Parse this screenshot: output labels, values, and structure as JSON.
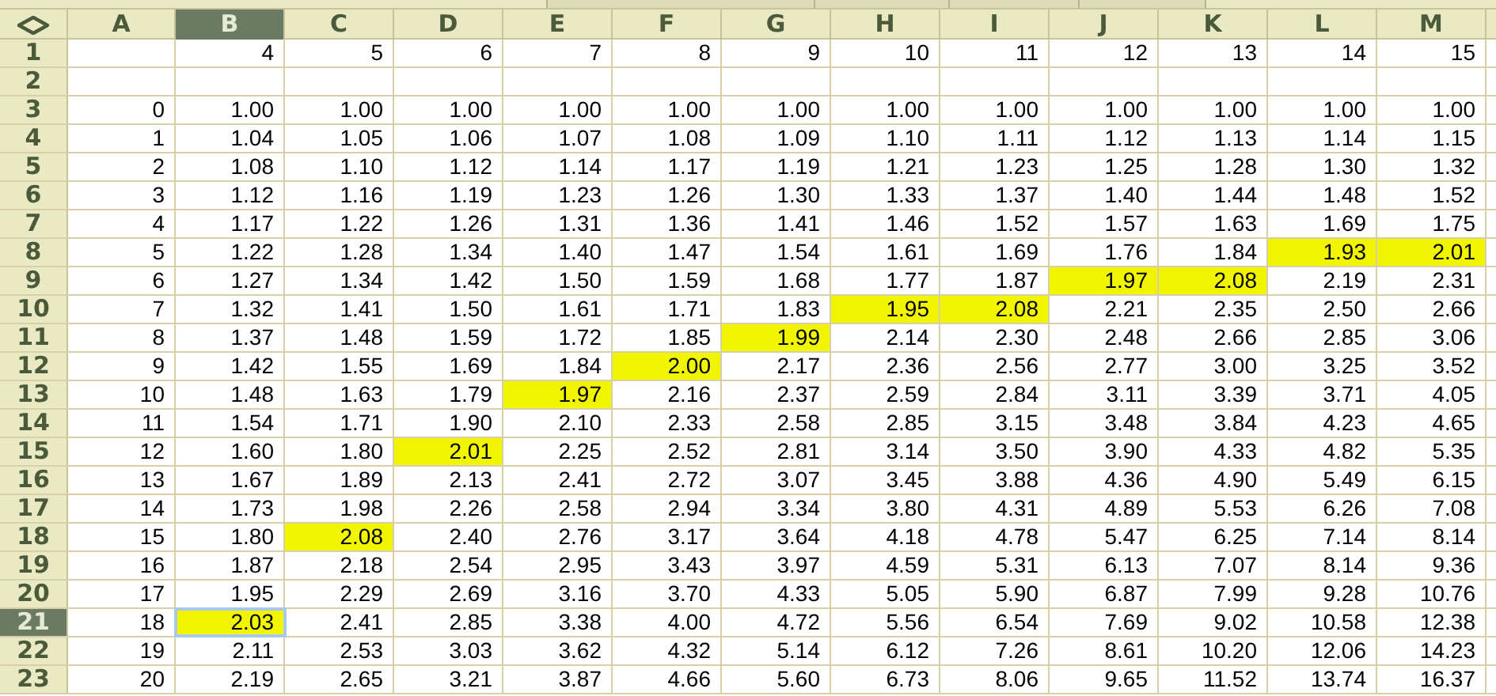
{
  "columns": [
    {
      "label": "A",
      "selected": false
    },
    {
      "label": "B",
      "selected": true
    },
    {
      "label": "C",
      "selected": false
    },
    {
      "label": "D",
      "selected": false
    },
    {
      "label": "E",
      "selected": false
    },
    {
      "label": "F",
      "selected": false
    },
    {
      "label": "G",
      "selected": false
    },
    {
      "label": "H",
      "selected": false
    },
    {
      "label": "I",
      "selected": false
    },
    {
      "label": "J",
      "selected": false
    },
    {
      "label": "K",
      "selected": false
    },
    {
      "label": "L",
      "selected": false
    },
    {
      "label": "M",
      "selected": false
    }
  ],
  "rows": [
    {
      "header": "1",
      "selected": false,
      "cells": [
        {
          "highlighted": false,
          "selected": false
        },
        {
          "text": "4",
          "highlighted": false,
          "selected": false
        },
        {
          "text": "5",
          "highlighted": false,
          "selected": false
        },
        {
          "text": "6",
          "highlighted": false,
          "selected": false
        },
        {
          "text": "7",
          "highlighted": false,
          "selected": false
        },
        {
          "text": "8",
          "highlighted": false,
          "selected": false
        },
        {
          "text": "9",
          "highlighted": false,
          "selected": false
        },
        {
          "text": "10",
          "highlighted": false,
          "selected": false
        },
        {
          "text": "11",
          "highlighted": false,
          "selected": false
        },
        {
          "text": "12",
          "highlighted": false,
          "selected": false
        },
        {
          "text": "13",
          "highlighted": false,
          "selected": false
        },
        {
          "text": "14",
          "highlighted": false,
          "selected": false
        },
        {
          "text": "15",
          "highlighted": false,
          "selected": false
        }
      ]
    },
    {
      "header": "2",
      "selected": false,
      "cells": [
        {
          "highlighted": false,
          "selected": false
        },
        {
          "highlighted": false,
          "selected": false
        },
        {
          "highlighted": false,
          "selected": false
        },
        {
          "highlighted": false,
          "selected": false
        },
        {
          "highlighted": false,
          "selected": false
        },
        {
          "highlighted": false,
          "selected": false
        },
        {
          "highlighted": false,
          "selected": false
        },
        {
          "highlighted": false,
          "selected": false
        },
        {
          "highlighted": false,
          "selected": false
        },
        {
          "highlighted": false,
          "selected": false
        },
        {
          "highlighted": false,
          "selected": false
        },
        {
          "highlighted": false,
          "selected": false
        },
        {
          "highlighted": false,
          "selected": false
        }
      ]
    },
    {
      "header": "3",
      "selected": false,
      "cells": [
        {
          "text": "0",
          "highlighted": false,
          "selected": false
        },
        {
          "text": "1.00",
          "highlighted": false,
          "selected": false
        },
        {
          "text": "1.00",
          "highlighted": false,
          "selected": false
        },
        {
          "text": "1.00",
          "highlighted": false,
          "selected": false
        },
        {
          "text": "1.00",
          "highlighted": false,
          "selected": false
        },
        {
          "text": "1.00",
          "highlighted": false,
          "selected": false
        },
        {
          "text": "1.00",
          "highlighted": false,
          "selected": false
        },
        {
          "text": "1.00",
          "highlighted": false,
          "selected": false
        },
        {
          "text": "1.00",
          "highlighted": false,
          "selected": false
        },
        {
          "text": "1.00",
          "highlighted": false,
          "selected": false
        },
        {
          "text": "1.00",
          "highlighted": false,
          "selected": false
        },
        {
          "text": "1.00",
          "highlighted": false,
          "selected": false
        },
        {
          "text": "1.00",
          "highlighted": false,
          "selected": false
        }
      ]
    },
    {
      "header": "4",
      "selected": false,
      "cells": [
        {
          "text": "1",
          "highlighted": false,
          "selected": false
        },
        {
          "text": "1.04",
          "highlighted": false,
          "selected": false
        },
        {
          "text": "1.05",
          "highlighted": false,
          "selected": false
        },
        {
          "text": "1.06",
          "highlighted": false,
          "selected": false
        },
        {
          "text": "1.07",
          "highlighted": false,
          "selected": false
        },
        {
          "text": "1.08",
          "highlighted": false,
          "selected": false
        },
        {
          "text": "1.09",
          "highlighted": false,
          "selected": false
        },
        {
          "text": "1.10",
          "highlighted": false,
          "selected": false
        },
        {
          "text": "1.11",
          "highlighted": false,
          "selected": false
        },
        {
          "text": "1.12",
          "highlighted": false,
          "selected": false
        },
        {
          "text": "1.13",
          "highlighted": false,
          "selected": false
        },
        {
          "text": "1.14",
          "highlighted": false,
          "selected": false
        },
        {
          "text": "1.15",
          "highlighted": false,
          "selected": false
        }
      ]
    },
    {
      "header": "5",
      "selected": false,
      "cells": [
        {
          "text": "2",
          "highlighted": false,
          "selected": false
        },
        {
          "text": "1.08",
          "highlighted": false,
          "selected": false
        },
        {
          "text": "1.10",
          "highlighted": false,
          "selected": false
        },
        {
          "text": "1.12",
          "highlighted": false,
          "selected": false
        },
        {
          "text": "1.14",
          "highlighted": false,
          "selected": false
        },
        {
          "text": "1.17",
          "highlighted": false,
          "selected": false
        },
        {
          "text": "1.19",
          "highlighted": false,
          "selected": false
        },
        {
          "text": "1.21",
          "highlighted": false,
          "selected": false
        },
        {
          "text": "1.23",
          "highlighted": false,
          "selected": false
        },
        {
          "text": "1.25",
          "highlighted": false,
          "selected": false
        },
        {
          "text": "1.28",
          "highlighted": false,
          "selected": false
        },
        {
          "text": "1.30",
          "highlighted": false,
          "selected": false
        },
        {
          "text": "1.32",
          "highlighted": false,
          "selected": false
        }
      ]
    },
    {
      "header": "6",
      "selected": false,
      "cells": [
        {
          "text": "3",
          "highlighted": false,
          "selected": false
        },
        {
          "text": "1.12",
          "highlighted": false,
          "selected": false
        },
        {
          "text": "1.16",
          "highlighted": false,
          "selected": false
        },
        {
          "text": "1.19",
          "highlighted": false,
          "selected": false
        },
        {
          "text": "1.23",
          "highlighted": false,
          "selected": false
        },
        {
          "text": "1.26",
          "highlighted": false,
          "selected": false
        },
        {
          "text": "1.30",
          "highlighted": false,
          "selected": false
        },
        {
          "text": "1.33",
          "highlighted": false,
          "selected": false
        },
        {
          "text": "1.37",
          "highlighted": false,
          "selected": false
        },
        {
          "text": "1.40",
          "highlighted": false,
          "selected": false
        },
        {
          "text": "1.44",
          "highlighted": false,
          "selected": false
        },
        {
          "text": "1.48",
          "highlighted": false,
          "selected": false
        },
        {
          "text": "1.52",
          "highlighted": false,
          "selected": false
        }
      ]
    },
    {
      "header": "7",
      "selected": false,
      "cells": [
        {
          "text": "4",
          "highlighted": false,
          "selected": false
        },
        {
          "text": "1.17",
          "highlighted": false,
          "selected": false
        },
        {
          "text": "1.22",
          "highlighted": false,
          "selected": false
        },
        {
          "text": "1.26",
          "highlighted": false,
          "selected": false
        },
        {
          "text": "1.31",
          "highlighted": false,
          "selected": false
        },
        {
          "text": "1.36",
          "highlighted": false,
          "selected": false
        },
        {
          "text": "1.41",
          "highlighted": false,
          "selected": false
        },
        {
          "text": "1.46",
          "highlighted": false,
          "selected": false
        },
        {
          "text": "1.52",
          "highlighted": false,
          "selected": false
        },
        {
          "text": "1.57",
          "highlighted": false,
          "selected": false
        },
        {
          "text": "1.63",
          "highlighted": false,
          "selected": false
        },
        {
          "text": "1.69",
          "highlighted": false,
          "selected": false
        },
        {
          "text": "1.75",
          "highlighted": false,
          "selected": false
        }
      ]
    },
    {
      "header": "8",
      "selected": false,
      "cells": [
        {
          "text": "5",
          "highlighted": false,
          "selected": false
        },
        {
          "text": "1.22",
          "highlighted": false,
          "selected": false
        },
        {
          "text": "1.28",
          "highlighted": false,
          "selected": false
        },
        {
          "text": "1.34",
          "highlighted": false,
          "selected": false
        },
        {
          "text": "1.40",
          "highlighted": false,
          "selected": false
        },
        {
          "text": "1.47",
          "highlighted": false,
          "selected": false
        },
        {
          "text": "1.54",
          "highlighted": false,
          "selected": false
        },
        {
          "text": "1.61",
          "highlighted": false,
          "selected": false
        },
        {
          "text": "1.69",
          "highlighted": false,
          "selected": false
        },
        {
          "text": "1.76",
          "highlighted": false,
          "selected": false
        },
        {
          "text": "1.84",
          "highlighted": false,
          "selected": false
        },
        {
          "text": "1.93",
          "highlighted": true,
          "selected": false
        },
        {
          "text": "2.01",
          "highlighted": true,
          "selected": false
        }
      ]
    },
    {
      "header": "9",
      "selected": false,
      "cells": [
        {
          "text": "6",
          "highlighted": false,
          "selected": false
        },
        {
          "text": "1.27",
          "highlighted": false,
          "selected": false
        },
        {
          "text": "1.34",
          "highlighted": false,
          "selected": false
        },
        {
          "text": "1.42",
          "highlighted": false,
          "selected": false
        },
        {
          "text": "1.50",
          "highlighted": false,
          "selected": false
        },
        {
          "text": "1.59",
          "highlighted": false,
          "selected": false
        },
        {
          "text": "1.68",
          "highlighted": false,
          "selected": false
        },
        {
          "text": "1.77",
          "highlighted": false,
          "selected": false
        },
        {
          "text": "1.87",
          "highlighted": false,
          "selected": false
        },
        {
          "text": "1.97",
          "highlighted": true,
          "selected": false
        },
        {
          "text": "2.08",
          "highlighted": true,
          "selected": false
        },
        {
          "text": "2.19",
          "highlighted": false,
          "selected": false
        },
        {
          "text": "2.31",
          "highlighted": false,
          "selected": false
        }
      ]
    },
    {
      "header": "10",
      "selected": false,
      "cells": [
        {
          "text": "7",
          "highlighted": false,
          "selected": false
        },
        {
          "text": "1.32",
          "highlighted": false,
          "selected": false
        },
        {
          "text": "1.41",
          "highlighted": false,
          "selected": false
        },
        {
          "text": "1.50",
          "highlighted": false,
          "selected": false
        },
        {
          "text": "1.61",
          "highlighted": false,
          "selected": false
        },
        {
          "text": "1.71",
          "highlighted": false,
          "selected": false
        },
        {
          "text": "1.83",
          "highlighted": false,
          "selected": false
        },
        {
          "text": "1.95",
          "highlighted": true,
          "selected": false
        },
        {
          "text": "2.08",
          "highlighted": true,
          "selected": false
        },
        {
          "text": "2.21",
          "highlighted": false,
          "selected": false
        },
        {
          "text": "2.35",
          "highlighted": false,
          "selected": false
        },
        {
          "text": "2.50",
          "highlighted": false,
          "selected": false
        },
        {
          "text": "2.66",
          "highlighted": false,
          "selected": false
        }
      ]
    },
    {
      "header": "11",
      "selected": false,
      "cells": [
        {
          "text": "8",
          "highlighted": false,
          "selected": false
        },
        {
          "text": "1.37",
          "highlighted": false,
          "selected": false
        },
        {
          "text": "1.48",
          "highlighted": false,
          "selected": false
        },
        {
          "text": "1.59",
          "highlighted": false,
          "selected": false
        },
        {
          "text": "1.72",
          "highlighted": false,
          "selected": false
        },
        {
          "text": "1.85",
          "highlighted": false,
          "selected": false
        },
        {
          "text": "1.99",
          "highlighted": true,
          "selected": false
        },
        {
          "text": "2.14",
          "highlighted": false,
          "selected": false
        },
        {
          "text": "2.30",
          "highlighted": false,
          "selected": false
        },
        {
          "text": "2.48",
          "highlighted": false,
          "selected": false
        },
        {
          "text": "2.66",
          "highlighted": false,
          "selected": false
        },
        {
          "text": "2.85",
          "highlighted": false,
          "selected": false
        },
        {
          "text": "3.06",
          "highlighted": false,
          "selected": false
        }
      ]
    },
    {
      "header": "12",
      "selected": false,
      "cells": [
        {
          "text": "9",
          "highlighted": false,
          "selected": false
        },
        {
          "text": "1.42",
          "highlighted": false,
          "selected": false
        },
        {
          "text": "1.55",
          "highlighted": false,
          "selected": false
        },
        {
          "text": "1.69",
          "highlighted": false,
          "selected": false
        },
        {
          "text": "1.84",
          "highlighted": false,
          "selected": false
        },
        {
          "text": "2.00",
          "highlighted": true,
          "selected": false
        },
        {
          "text": "2.17",
          "highlighted": false,
          "selected": false
        },
        {
          "text": "2.36",
          "highlighted": false,
          "selected": false
        },
        {
          "text": "2.56",
          "highlighted": false,
          "selected": false
        },
        {
          "text": "2.77",
          "highlighted": false,
          "selected": false
        },
        {
          "text": "3.00",
          "highlighted": false,
          "selected": false
        },
        {
          "text": "3.25",
          "highlighted": false,
          "selected": false
        },
        {
          "text": "3.52",
          "highlighted": false,
          "selected": false
        }
      ]
    },
    {
      "header": "13",
      "selected": false,
      "cells": [
        {
          "text": "10",
          "highlighted": false,
          "selected": false
        },
        {
          "text": "1.48",
          "highlighted": false,
          "selected": false
        },
        {
          "text": "1.63",
          "highlighted": false,
          "selected": false
        },
        {
          "text": "1.79",
          "highlighted": false,
          "selected": false
        },
        {
          "text": "1.97",
          "highlighted": true,
          "selected": false
        },
        {
          "text": "2.16",
          "highlighted": false,
          "selected": false
        },
        {
          "text": "2.37",
          "highlighted": false,
          "selected": false
        },
        {
          "text": "2.59",
          "highlighted": false,
          "selected": false
        },
        {
          "text": "2.84",
          "highlighted": false,
          "selected": false
        },
        {
          "text": "3.11",
          "highlighted": false,
          "selected": false
        },
        {
          "text": "3.39",
          "highlighted": false,
          "selected": false
        },
        {
          "text": "3.71",
          "highlighted": false,
          "selected": false
        },
        {
          "text": "4.05",
          "highlighted": false,
          "selected": false
        }
      ]
    },
    {
      "header": "14",
      "selected": false,
      "cells": [
        {
          "text": "11",
          "highlighted": false,
          "selected": false
        },
        {
          "text": "1.54",
          "highlighted": false,
          "selected": false
        },
        {
          "text": "1.71",
          "highlighted": false,
          "selected": false
        },
        {
          "text": "1.90",
          "highlighted": false,
          "selected": false
        },
        {
          "text": "2.10",
          "highlighted": false,
          "selected": false
        },
        {
          "text": "2.33",
          "highlighted": false,
          "selected": false
        },
        {
          "text": "2.58",
          "highlighted": false,
          "selected": false
        },
        {
          "text": "2.85",
          "highlighted": false,
          "selected": false
        },
        {
          "text": "3.15",
          "highlighted": false,
          "selected": false
        },
        {
          "text": "3.48",
          "highlighted": false,
          "selected": false
        },
        {
          "text": "3.84",
          "highlighted": false,
          "selected": false
        },
        {
          "text": "4.23",
          "highlighted": false,
          "selected": false
        },
        {
          "text": "4.65",
          "highlighted": false,
          "selected": false
        }
      ]
    },
    {
      "header": "15",
      "selected": false,
      "cells": [
        {
          "text": "12",
          "highlighted": false,
          "selected": false
        },
        {
          "text": "1.60",
          "highlighted": false,
          "selected": false
        },
        {
          "text": "1.80",
          "highlighted": false,
          "selected": false
        },
        {
          "text": "2.01",
          "highlighted": true,
          "selected": false
        },
        {
          "text": "2.25",
          "highlighted": false,
          "selected": false
        },
        {
          "text": "2.52",
          "highlighted": false,
          "selected": false
        },
        {
          "text": "2.81",
          "highlighted": false,
          "selected": false
        },
        {
          "text": "3.14",
          "highlighted": false,
          "selected": false
        },
        {
          "text": "3.50",
          "highlighted": false,
          "selected": false
        },
        {
          "text": "3.90",
          "highlighted": false,
          "selected": false
        },
        {
          "text": "4.33",
          "highlighted": false,
          "selected": false
        },
        {
          "text": "4.82",
          "highlighted": false,
          "selected": false
        },
        {
          "text": "5.35",
          "highlighted": false,
          "selected": false
        }
      ]
    },
    {
      "header": "16",
      "selected": false,
      "cells": [
        {
          "text": "13",
          "highlighted": false,
          "selected": false
        },
        {
          "text": "1.67",
          "highlighted": false,
          "selected": false
        },
        {
          "text": "1.89",
          "highlighted": false,
          "selected": false
        },
        {
          "text": "2.13",
          "highlighted": false,
          "selected": false
        },
        {
          "text": "2.41",
          "highlighted": false,
          "selected": false
        },
        {
          "text": "2.72",
          "highlighted": false,
          "selected": false
        },
        {
          "text": "3.07",
          "highlighted": false,
          "selected": false
        },
        {
          "text": "3.45",
          "highlighted": false,
          "selected": false
        },
        {
          "text": "3.88",
          "highlighted": false,
          "selected": false
        },
        {
          "text": "4.36",
          "highlighted": false,
          "selected": false
        },
        {
          "text": "4.90",
          "highlighted": false,
          "selected": false
        },
        {
          "text": "5.49",
          "highlighted": false,
          "selected": false
        },
        {
          "text": "6.15",
          "highlighted": false,
          "selected": false
        }
      ]
    },
    {
      "header": "17",
      "selected": false,
      "cells": [
        {
          "text": "14",
          "highlighted": false,
          "selected": false
        },
        {
          "text": "1.73",
          "highlighted": false,
          "selected": false
        },
        {
          "text": "1.98",
          "highlighted": false,
          "selected": false
        },
        {
          "text": "2.26",
          "highlighted": false,
          "selected": false
        },
        {
          "text": "2.58",
          "highlighted": false,
          "selected": false
        },
        {
          "text": "2.94",
          "highlighted": false,
          "selected": false
        },
        {
          "text": "3.34",
          "highlighted": false,
          "selected": false
        },
        {
          "text": "3.80",
          "highlighted": false,
          "selected": false
        },
        {
          "text": "4.31",
          "highlighted": false,
          "selected": false
        },
        {
          "text": "4.89",
          "highlighted": false,
          "selected": false
        },
        {
          "text": "5.53",
          "highlighted": false,
          "selected": false
        },
        {
          "text": "6.26",
          "highlighted": false,
          "selected": false
        },
        {
          "text": "7.08",
          "highlighted": false,
          "selected": false
        }
      ]
    },
    {
      "header": "18",
      "selected": false,
      "cells": [
        {
          "text": "15",
          "highlighted": false,
          "selected": false
        },
        {
          "text": "1.80",
          "highlighted": false,
          "selected": false
        },
        {
          "text": "2.08",
          "highlighted": true,
          "selected": false
        },
        {
          "text": "2.40",
          "highlighted": false,
          "selected": false
        },
        {
          "text": "2.76",
          "highlighted": false,
          "selected": false
        },
        {
          "text": "3.17",
          "highlighted": false,
          "selected": false
        },
        {
          "text": "3.64",
          "highlighted": false,
          "selected": false
        },
        {
          "text": "4.18",
          "highlighted": false,
          "selected": false
        },
        {
          "text": "4.78",
          "highlighted": false,
          "selected": false
        },
        {
          "text": "5.47",
          "highlighted": false,
          "selected": false
        },
        {
          "text": "6.25",
          "highlighted": false,
          "selected": false
        },
        {
          "text": "7.14",
          "highlighted": false,
          "selected": false
        },
        {
          "text": "8.14",
          "highlighted": false,
          "selected": false
        }
      ]
    },
    {
      "header": "19",
      "selected": false,
      "cells": [
        {
          "text": "16",
          "highlighted": false,
          "selected": false
        },
        {
          "text": "1.87",
          "highlighted": false,
          "selected": false
        },
        {
          "text": "2.18",
          "highlighted": false,
          "selected": false
        },
        {
          "text": "2.54",
          "highlighted": false,
          "selected": false
        },
        {
          "text": "2.95",
          "highlighted": false,
          "selected": false
        },
        {
          "text": "3.43",
          "highlighted": false,
          "selected": false
        },
        {
          "text": "3.97",
          "highlighted": false,
          "selected": false
        },
        {
          "text": "4.59",
          "highlighted": false,
          "selected": false
        },
        {
          "text": "5.31",
          "highlighted": false,
          "selected": false
        },
        {
          "text": "6.13",
          "highlighted": false,
          "selected": false
        },
        {
          "text": "7.07",
          "highlighted": false,
          "selected": false
        },
        {
          "text": "8.14",
          "highlighted": false,
          "selected": false
        },
        {
          "text": "9.36",
          "highlighted": false,
          "selected": false
        }
      ]
    },
    {
      "header": "20",
      "selected": false,
      "cells": [
        {
          "text": "17",
          "highlighted": false,
          "selected": false
        },
        {
          "text": "1.95",
          "highlighted": false,
          "selected": false
        },
        {
          "text": "2.29",
          "highlighted": false,
          "selected": false
        },
        {
          "text": "2.69",
          "highlighted": false,
          "selected": false
        },
        {
          "text": "3.16",
          "highlighted": false,
          "selected": false
        },
        {
          "text": "3.70",
          "highlighted": false,
          "selected": false
        },
        {
          "text": "4.33",
          "highlighted": false,
          "selected": false
        },
        {
          "text": "5.05",
          "highlighted": false,
          "selected": false
        },
        {
          "text": "5.90",
          "highlighted": false,
          "selected": false
        },
        {
          "text": "6.87",
          "highlighted": false,
          "selected": false
        },
        {
          "text": "7.99",
          "highlighted": false,
          "selected": false
        },
        {
          "text": "9.28",
          "highlighted": false,
          "selected": false
        },
        {
          "text": "10.76",
          "highlighted": false,
          "selected": false
        }
      ]
    },
    {
      "header": "21",
      "selected": true,
      "cells": [
        {
          "text": "18",
          "highlighted": false,
          "selected": false
        },
        {
          "text": "2.03",
          "highlighted": true,
          "selected": true
        },
        {
          "text": "2.41",
          "highlighted": false,
          "selected": false
        },
        {
          "text": "2.85",
          "highlighted": false,
          "selected": false
        },
        {
          "text": "3.38",
          "highlighted": false,
          "selected": false
        },
        {
          "text": "4.00",
          "highlighted": false,
          "selected": false
        },
        {
          "text": "4.72",
          "highlighted": false,
          "selected": false
        },
        {
          "text": "5.56",
          "highlighted": false,
          "selected": false
        },
        {
          "text": "6.54",
          "highlighted": false,
          "selected": false
        },
        {
          "text": "7.69",
          "highlighted": false,
          "selected": false
        },
        {
          "text": "9.02",
          "highlighted": false,
          "selected": false
        },
        {
          "text": "10.58",
          "highlighted": false,
          "selected": false
        },
        {
          "text": "12.38",
          "highlighted": false,
          "selected": false
        }
      ]
    },
    {
      "header": "22",
      "selected": false,
      "cells": [
        {
          "text": "19",
          "highlighted": false,
          "selected": false
        },
        {
          "text": "2.11",
          "highlighted": false,
          "selected": false
        },
        {
          "text": "2.53",
          "highlighted": false,
          "selected": false
        },
        {
          "text": "3.03",
          "highlighted": false,
          "selected": false
        },
        {
          "text": "3.62",
          "highlighted": false,
          "selected": false
        },
        {
          "text": "4.32",
          "highlighted": false,
          "selected": false
        },
        {
          "text": "5.14",
          "highlighted": false,
          "selected": false
        },
        {
          "text": "6.12",
          "highlighted": false,
          "selected": false
        },
        {
          "text": "7.26",
          "highlighted": false,
          "selected": false
        },
        {
          "text": "8.61",
          "highlighted": false,
          "selected": false
        },
        {
          "text": "10.20",
          "highlighted": false,
          "selected": false
        },
        {
          "text": "12.06",
          "highlighted": false,
          "selected": false
        },
        {
          "text": "14.23",
          "highlighted": false,
          "selected": false
        }
      ]
    },
    {
      "header": "23",
      "selected": false,
      "cells": [
        {
          "text": "20",
          "highlighted": false,
          "selected": false
        },
        {
          "text": "2.19",
          "highlighted": false,
          "selected": false
        },
        {
          "text": "2.65",
          "highlighted": false,
          "selected": false
        },
        {
          "text": "3.21",
          "highlighted": false,
          "selected": false
        },
        {
          "text": "3.87",
          "highlighted": false,
          "selected": false
        },
        {
          "text": "4.66",
          "highlighted": false,
          "selected": false
        },
        {
          "text": "5.60",
          "highlighted": false,
          "selected": false
        },
        {
          "text": "6.73",
          "highlighted": false,
          "selected": false
        },
        {
          "text": "8.06",
          "highlighted": false,
          "selected": false
        },
        {
          "text": "9.65",
          "highlighted": false,
          "selected": false
        },
        {
          "text": "11.52",
          "highlighted": false,
          "selected": false
        },
        {
          "text": "13.74",
          "highlighted": false,
          "selected": false
        },
        {
          "text": "16.37",
          "highlighted": false,
          "selected": false
        }
      ]
    }
  ]
}
